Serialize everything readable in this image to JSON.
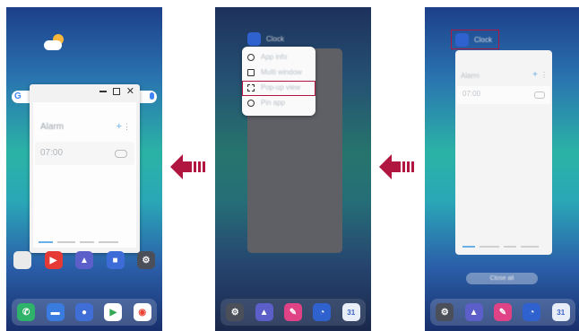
{
  "panel1": {
    "window": {
      "title": "Alarm",
      "time": "07:00",
      "controls": [
        "minimize",
        "maximize",
        "close"
      ]
    }
  },
  "panel2": {
    "app_name": "Clock",
    "menu": [
      "App info",
      "Multi window",
      "Pop-up view",
      "Pin app"
    ]
  },
  "panel3": {
    "app_name": "Clock",
    "card_title": "Alarm",
    "time": "07:00",
    "close_all": "Close all"
  },
  "colors": {
    "accent": "#b0163f",
    "arrow": "#b0163f"
  }
}
